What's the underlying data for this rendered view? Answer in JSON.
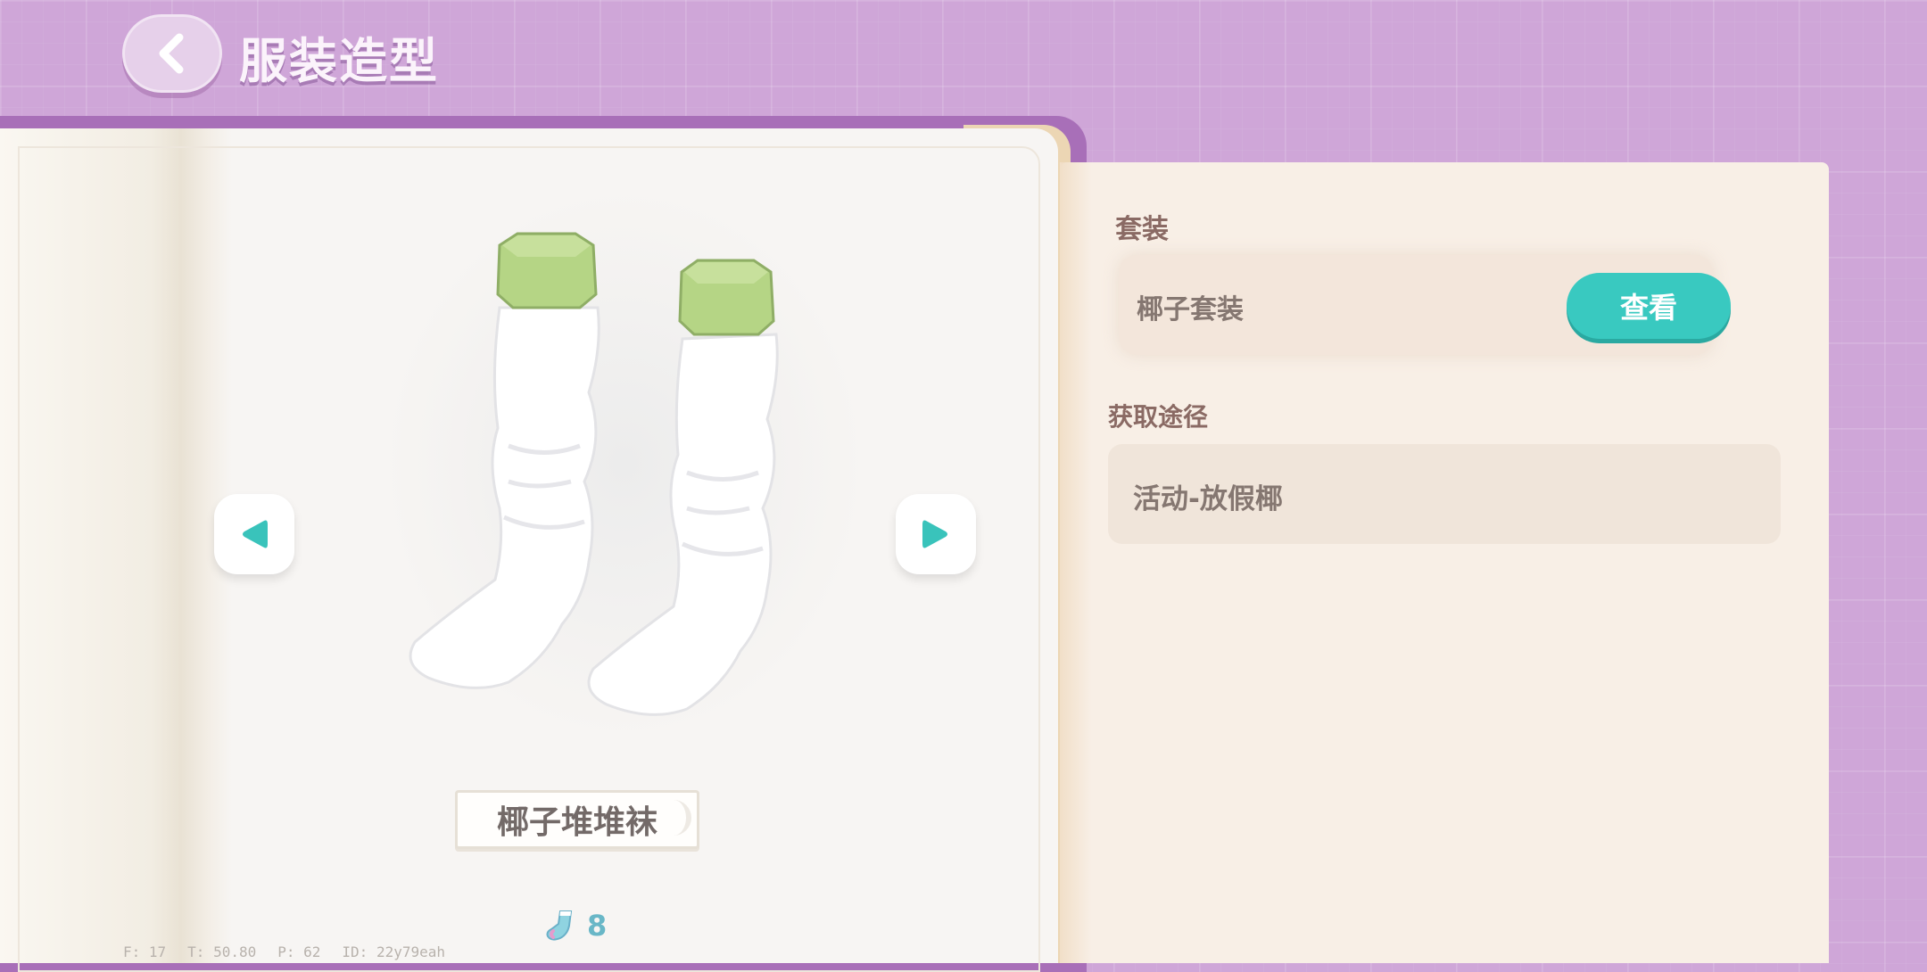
{
  "header": {
    "title": "服装造型"
  },
  "item": {
    "name": "椰子堆堆袜",
    "count": "8"
  },
  "info": {
    "set_section_label": "套装",
    "set_name": "椰子套装",
    "view_button_label": "查看",
    "source_section_label": "获取途径",
    "source_text": "活动-放假椰"
  },
  "debug": {
    "f": "F: 17",
    "t": "T: 50.80",
    "p": "P: 62",
    "id": "ID: 22y79eah"
  },
  "colors": {
    "background": "#cfa6d8",
    "accent_teal": "#39c9c0",
    "sock_cuff": "#b5d585",
    "page": "#f7f5f3",
    "panel": "#f8efe6"
  },
  "icons": {
    "back": "chevron-left-icon",
    "prev": "triangle-left-icon",
    "next": "triangle-right-icon",
    "count": "sock-token-icon"
  }
}
